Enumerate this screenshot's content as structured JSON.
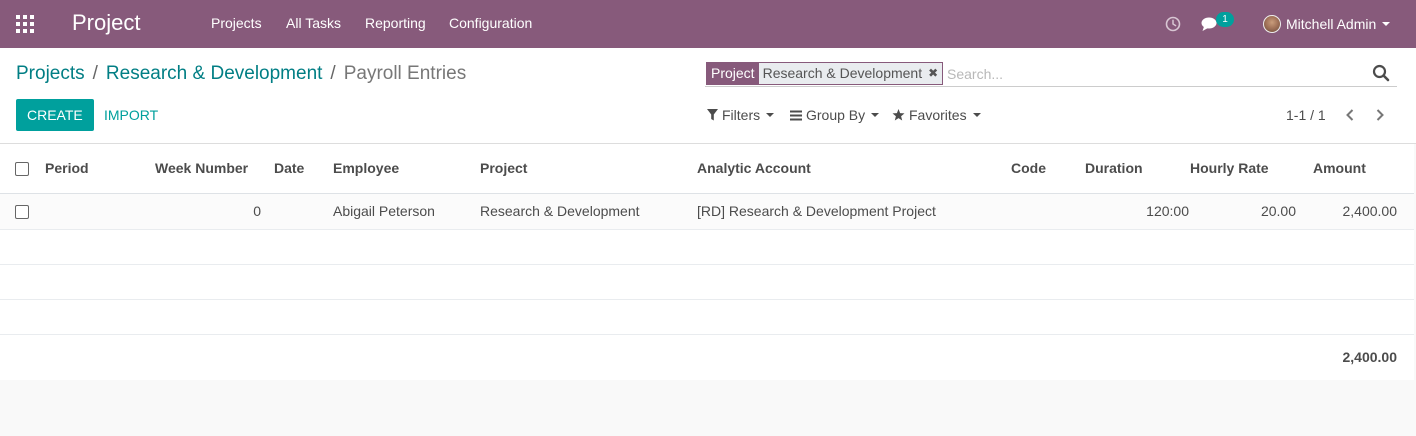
{
  "navbar": {
    "apps_icon": "grid-icon",
    "brand": "Project",
    "menu": [
      "Projects",
      "All Tasks",
      "Reporting",
      "Configuration"
    ],
    "activity_icon": "clock-icon",
    "chat_icon": "comments-icon",
    "chat_badge": "1",
    "user_name": "Mitchell Admin",
    "color": "#875a7b"
  },
  "breadcrumb": {
    "items": [
      "Projects",
      "Research & Development"
    ],
    "separator": "/",
    "current": "Payroll Entries"
  },
  "buttons": {
    "create": "Create",
    "import": "Import"
  },
  "search": {
    "facet_label": "Project",
    "facet_value": "Research & Development",
    "placeholder": "Search..."
  },
  "search_options": {
    "filters": "Filters",
    "group_by": "Group By",
    "favorites": "Favorites"
  },
  "pager": {
    "value": "1-1 / 1"
  },
  "list": {
    "columns": [
      "Period",
      "Week Number",
      "Date",
      "Employee",
      "Project",
      "Analytic Account",
      "Code",
      "Duration",
      "Hourly Rate",
      "Amount"
    ],
    "rows": [
      {
        "period": "",
        "week_number": "0",
        "date": "",
        "employee": "Abigail Peterson",
        "project": "Research & Development",
        "analytic_account": "[RD] Research & Development Project",
        "code": "",
        "duration": "120:00",
        "hourly_rate": "20.00",
        "amount": "2,400.00"
      }
    ],
    "total_amount": "2,400.00"
  },
  "colors": {
    "primary": "#00a09d",
    "link": "#017e84",
    "brand": "#875a7b"
  }
}
